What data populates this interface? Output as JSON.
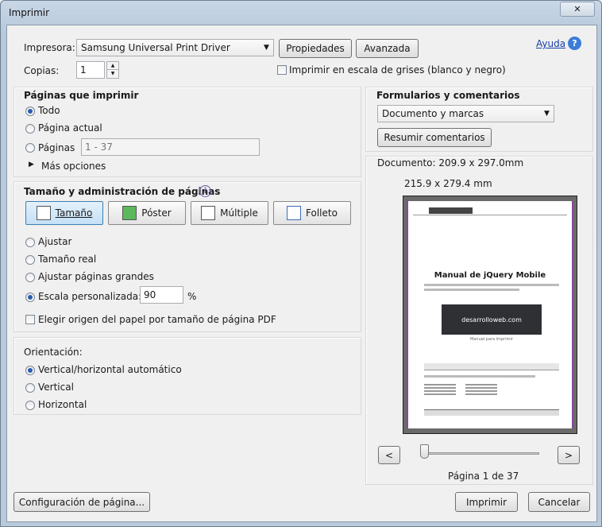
{
  "window": {
    "title": "Imprimir",
    "close_glyph": "✕"
  },
  "printer": {
    "label": "Impresora:",
    "value": "Samsung Universal Print Driver",
    "properties_btn": "Propiedades",
    "advanced_btn": "Avanzada",
    "help_link": "Ayuda",
    "help_icon": "?"
  },
  "copies": {
    "label": "Copias:",
    "value": "1",
    "grayscale_label": "Imprimir en escala de grises (blanco y negro)"
  },
  "pages": {
    "title": "Páginas que imprimir",
    "all": "Todo",
    "current": "Página actual",
    "pages_label": "Páginas",
    "range_placeholder": "1 - 37",
    "more": "Más opciones"
  },
  "sizing": {
    "title": "Tamaño y administración de páginas",
    "info_icon": "i",
    "tab_size": "Tamaño",
    "tab_poster": "Póster",
    "tab_multiple": "Múltiple",
    "tab_booklet": "Folleto",
    "fit": "Ajustar",
    "actual": "Tamaño real",
    "shrink": "Ajustar páginas grandes",
    "custom": "Escala personalizada:",
    "custom_value": "90",
    "percent": "%",
    "pdf_source": "Elegir origen del papel por tamaño de página PDF"
  },
  "orientation": {
    "title": "Orientación:",
    "auto": "Vertical/horizontal automático",
    "portrait": "Vertical",
    "landscape": "Horizontal"
  },
  "comments": {
    "title": "Formularios y comentarios",
    "value": "Documento y marcas",
    "summarize_btn": "Resumir comentarios"
  },
  "preview": {
    "document_size": "Documento: 209.9 x 297.0mm",
    "paper_size": "215.9 x 279.4 mm",
    "doc_title": "Manual de jQuery Mobile",
    "logo_text": "desarrolloweb.com",
    "logo_sub": "Manual para imprimir",
    "slider_value": 0.0,
    "prev": "<",
    "next": ">",
    "page_status": "Página 1 de 37"
  },
  "footer": {
    "page_setup_btn": "Configuración de página...",
    "print_btn": "Imprimir",
    "cancel_btn": "Cancelar"
  },
  "colors": {
    "accent": "#2a5db0",
    "link": "#1a3fa8",
    "page_border": "#8a4a9c"
  }
}
